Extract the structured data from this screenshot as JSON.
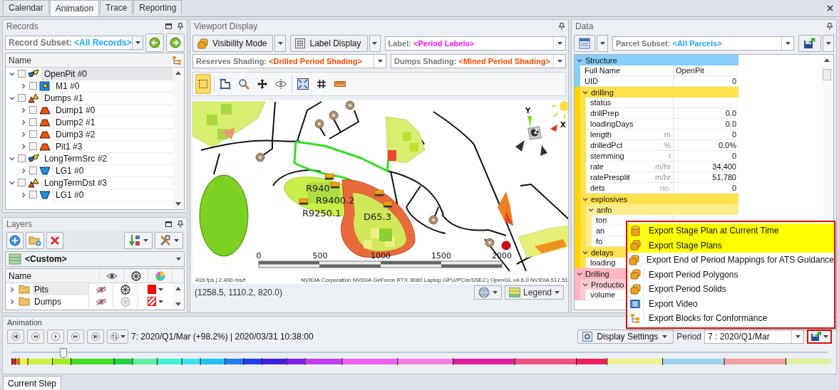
{
  "tabs": [
    {
      "label": "Calendar",
      "selected": false
    },
    {
      "label": "Animation",
      "selected": true
    },
    {
      "label": "Trace",
      "selected": false
    },
    {
      "label": "Reporting",
      "selected": false
    }
  ],
  "records": {
    "title": "Records",
    "subset": {
      "label": "Record Subset:",
      "value": "<All Records>"
    },
    "column": "Name",
    "tree": [
      {
        "label": "OpenPit #0",
        "kind": "pit",
        "checked": false,
        "expanded": true,
        "selected": true,
        "children": [
          {
            "label": "M1 #0",
            "kind": "block",
            "checked": false,
            "expanded": false,
            "selected": false
          }
        ]
      },
      {
        "label": "Dumps #1",
        "kind": "dumps",
        "checked": false,
        "expanded": true,
        "selected": false,
        "children": [
          {
            "label": "Dump1 #0",
            "kind": "dump",
            "checked": false,
            "expanded": false,
            "selected": false
          },
          {
            "label": "Dump2 #1",
            "kind": "dump",
            "checked": false,
            "expanded": false,
            "selected": false
          },
          {
            "label": "Dump3 #2",
            "kind": "dump",
            "checked": false,
            "expanded": false,
            "selected": false
          },
          {
            "label": "Pit1 #3",
            "kind": "dump",
            "checked": false,
            "expanded": false,
            "selected": false
          }
        ]
      },
      {
        "label": "LongTermSrc #2",
        "kind": "pit",
        "checked": false,
        "expanded": true,
        "selected": false,
        "children": [
          {
            "label": "LG1 #0",
            "kind": "trough",
            "checked": false,
            "expanded": false,
            "selected": false
          }
        ]
      },
      {
        "label": "LongTermDst #3",
        "kind": "dumps",
        "checked": false,
        "expanded": true,
        "selected": false,
        "children": [
          {
            "label": "LG1 #0",
            "kind": "trough",
            "checked": false,
            "expanded": false,
            "selected": false
          }
        ]
      }
    ]
  },
  "layers": {
    "title": "Layers",
    "scheme": "<Custom>",
    "column": "Name",
    "rows": [
      {
        "label": "Pits",
        "expanded": false,
        "selected": true,
        "visible": false,
        "color": "#ff0000",
        "kind": "solid"
      },
      {
        "label": "Dumps",
        "expanded": false,
        "selected": false,
        "visible": false,
        "color": "#ff0000",
        "kind": "hatched"
      }
    ]
  },
  "viewport": {
    "title": "Viewport Display",
    "visibility_button": "Visibility Mode",
    "label_button": "Label Display",
    "label_field": {
      "label": "Label:",
      "value": "<Period Labels>"
    },
    "reserves_field": {
      "label": "Reserves Shading:",
      "value": "<Drilled Period Shading>"
    },
    "dumps_field": {
      "label": "Dumps Shading:",
      "value": "<Mined Period Shading>"
    },
    "tools": [
      {
        "kind": "select",
        "selected": true
      },
      {
        "kind": "polygon",
        "selected": false
      },
      {
        "kind": "zoom",
        "selected": false
      },
      {
        "kind": "pan",
        "selected": false
      },
      {
        "kind": "rotate",
        "selected": false
      },
      {
        "kind": "extents",
        "selected": false
      },
      {
        "kind": "grid",
        "selected": false
      },
      {
        "kind": "ruler",
        "selected": false
      }
    ],
    "map": {
      "pit_labels": [
        "R940",
        "R9400.2",
        "R9250.1",
        "D65.3"
      ],
      "axis_labels": [
        "Y",
        "X",
        "Z"
      ],
      "scale_labels": [
        "0",
        "500",
        "1000",
        "1500",
        "2000"
      ],
      "fps": "416 fps | 2.400 ms/f",
      "renderer": "NVIDIA Corporation NVIDIA GeForce RTX 3080 Laptop GPU/PCIe/SSE2 | OpenGL v4.6.0 NVIDIA 517.51"
    },
    "coordinates": "(1258.5, 1110.2, 820.0)",
    "legend_button": "Legend"
  },
  "data": {
    "title": "Data",
    "subset": {
      "label": "Parcel Subset:",
      "value": "<All Parcels>"
    },
    "grid": [
      {
        "kind": "category",
        "label": "Structure",
        "color": "#87cefa",
        "expanded": true,
        "children": [
          {
            "kind": "text",
            "name": "Full Name",
            "value": "OpenPit"
          },
          {
            "kind": "field",
            "name": "UID",
            "value": "0"
          }
        ]
      },
      {
        "kind": "category",
        "color": "#ffd400",
        "children": [
          {
            "kind": "category",
            "label": "drilling",
            "expanded": true,
            "children": [
              {
                "kind": "field",
                "name": "status"
              },
              {
                "kind": "field",
                "name": "drillPrep",
                "value": "0.0"
              },
              {
                "kind": "field",
                "name": "loadingDays",
                "value": "0.0"
              },
              {
                "kind": "field",
                "name": "length",
                "unit": "m",
                "value": "0"
              },
              {
                "kind": "field",
                "name": "drilledPct",
                "unit": "%",
                "value": "0.0%"
              },
              {
                "kind": "field",
                "name": "stemming",
                "unit": "t",
                "value": "0"
              },
              {
                "kind": "field",
                "name": "rate",
                "unit": "m/hr",
                "value": "34,400"
              },
              {
                "kind": "field",
                "name": "ratePresplit",
                "unit": "m/hr",
                "value": "51,780"
              },
              {
                "kind": "field",
                "name": "dets",
                "unit": "no.",
                "value": "0"
              }
            ]
          },
          {
            "kind": "category",
            "label": "explosives",
            "expanded": true,
            "children": [
              {
                "kind": "category",
                "label": "anfo",
                "expanded": true,
                "children": [
                  {
                    "kind": "field",
                    "name": "ton"
                  },
                  {
                    "kind": "field",
                    "name": "an"
                  },
                  {
                    "kind": "field",
                    "name": "fo"
                  }
                ]
              }
            ]
          },
          {
            "kind": "category",
            "label": "delays",
            "expanded": true,
            "children": [
              {
                "kind": "field",
                "name": "loading"
              }
            ]
          }
        ]
      },
      {
        "kind": "category",
        "label": "Drilling",
        "color": "#ffb6c1",
        "expanded": true,
        "children": [
          {
            "kind": "category",
            "label": "Productio",
            "expanded": true,
            "children": [
              {
                "kind": "field",
                "name": "volume"
              }
            ]
          }
        ]
      }
    ]
  },
  "animation": {
    "title": "Animation",
    "status": "7: 2020/Q1/Mar (+98.2%) | 2020/03/31 10:38:00",
    "display_settings": "Display Settings",
    "period_label": "Period",
    "period_value": "7 : 2020/Q1/Mar",
    "timeline": {
      "level": 0.063
    },
    "export_open": true,
    "export_menu": [
      {
        "label": "Export Stage Plan at Current Time",
        "kind": "cube",
        "selected": true
      },
      {
        "label": "Export Stage Plans",
        "kind": "cubes",
        "selected": true
      },
      {
        "label": "Export End of Period Mappings for ATS Guidance",
        "kind": "cubes",
        "selected": false
      },
      {
        "label": "Export Period Polygons",
        "kind": "cubes",
        "selected": false
      },
      {
        "label": "Export Period Solids",
        "kind": "cubes",
        "selected": false
      },
      {
        "label": "Export Video",
        "kind": "film",
        "selected": false
      },
      {
        "label": "Export Blocks for Conformance",
        "kind": "tree",
        "selected": false
      }
    ]
  },
  "bottom_tabs": [
    {
      "label": "Current Step",
      "selected": true
    }
  ]
}
